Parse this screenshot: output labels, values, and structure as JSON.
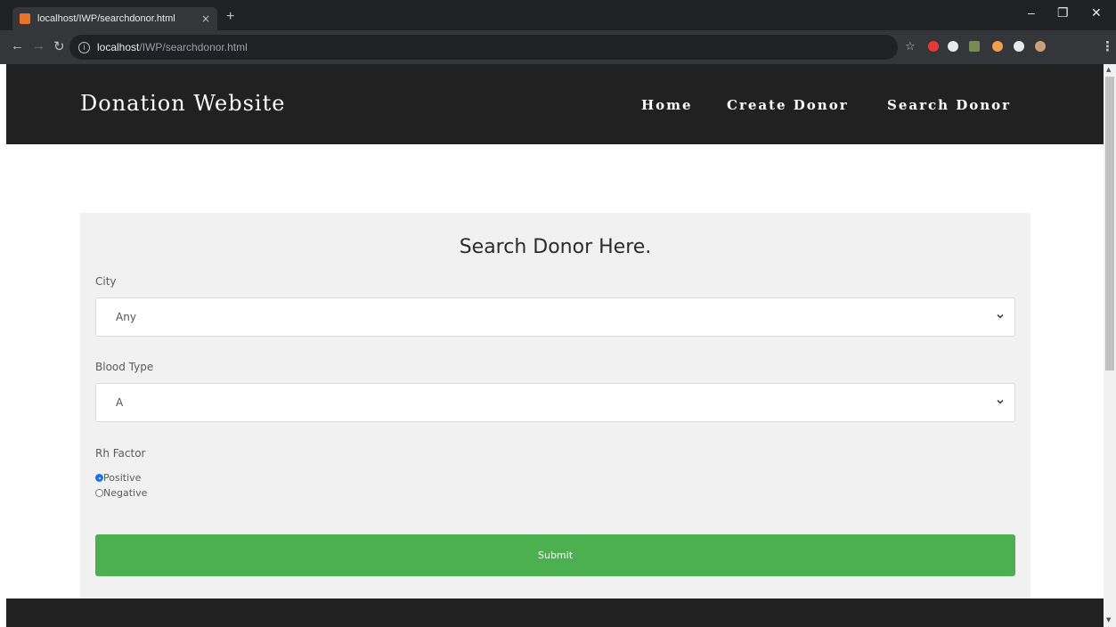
{
  "browser": {
    "tab_title": "localhost/IWP/searchdonor.html",
    "tab_close": "×",
    "new_tab": "+",
    "url_host": "localhost",
    "url_path": "/IWP/searchdonor.html",
    "window_controls": {
      "minimize": "–",
      "maximize": "❐",
      "close": "✕"
    }
  },
  "header": {
    "brand": "Donation Website",
    "nav": {
      "home": "Home",
      "create": "Create Donor",
      "search": "Search Donor"
    }
  },
  "form": {
    "title": "Search Donor Here.",
    "city": {
      "label": "City",
      "value": "Any"
    },
    "blood_type": {
      "label": "Blood Type",
      "value": "A"
    },
    "rh_factor": {
      "label": "Rh Factor",
      "options": [
        {
          "label": "Positive",
          "checked": true
        },
        {
          "label": "Negative",
          "checked": false
        }
      ]
    },
    "submit_label": "Submit"
  },
  "colors": {
    "header_bg": "#212121",
    "card_bg": "#f1f1f1",
    "submit_green": "#4caf50",
    "radio_accent": "#1a73e8"
  }
}
